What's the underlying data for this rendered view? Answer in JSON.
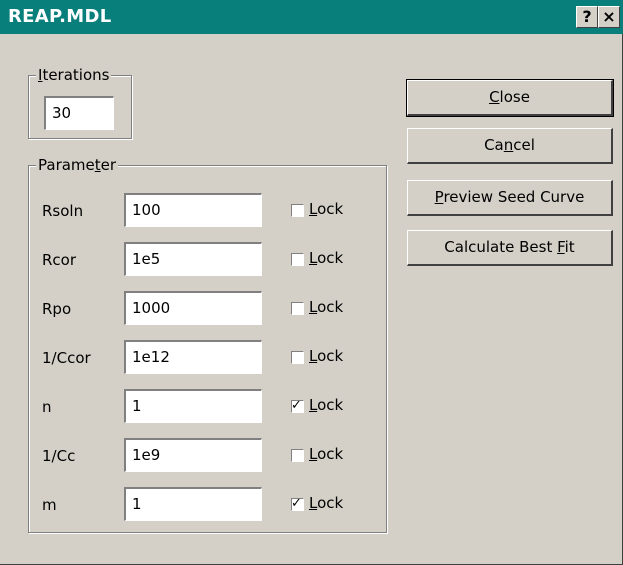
{
  "window": {
    "title": "REAP.MDL",
    "help_glyph": "?",
    "close_glyph": "×"
  },
  "iterations": {
    "legend": "Iterations",
    "value": "30"
  },
  "parameters": {
    "legend": "Parameter",
    "lock_label": "Lock",
    "rows": [
      {
        "name": "Rsoln",
        "value": "100",
        "locked": false
      },
      {
        "name": "Rcor",
        "value": "1e5",
        "locked": false
      },
      {
        "name": "Rpo",
        "value": "1000",
        "locked": false
      },
      {
        "name": "1/Ccor",
        "value": "1e12",
        "locked": false
      },
      {
        "name": "n",
        "value": "1",
        "locked": true
      },
      {
        "name": "1/Cc",
        "value": "1e9",
        "locked": false
      },
      {
        "name": "m",
        "value": "1",
        "locked": true
      }
    ]
  },
  "buttons": {
    "close": "Close",
    "cancel": "Cancel",
    "preview": "Preview Seed Curve",
    "calculate": "Calculate Best Fit"
  },
  "colors": {
    "titlebar": "#087f7b",
    "face": "#d4d0c8"
  }
}
